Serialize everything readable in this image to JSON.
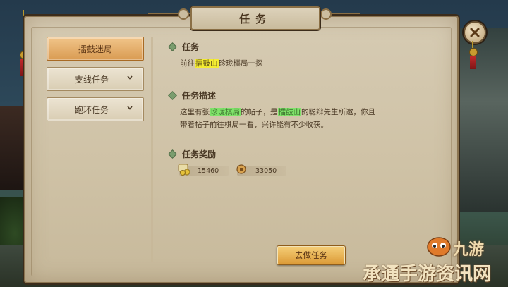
{
  "window": {
    "title": "任务"
  },
  "sidebar": {
    "items": [
      {
        "label": "擂鼓迷局",
        "active": true
      },
      {
        "label": "支线任务",
        "active": false
      },
      {
        "label": "跑环任务",
        "active": false
      }
    ]
  },
  "quest": {
    "objective_title": "任务",
    "objective_prefix": "前往",
    "objective_location": "擂鼓山",
    "objective_suffix": "珍珑棋局一探",
    "description_title": "任务描述",
    "description_p1": "这里有张",
    "description_item": "珍珑棋局",
    "description_p2": "的帖子，是",
    "description_npc": "擂鼓山",
    "description_p3": "的聪辩先生所邀，你且",
    "description_line2": "带着帖子前往棋局一看，兴许能有不少收获。",
    "rewards_title": "任务奖励",
    "rewards": [
      {
        "icon": "exp-scroll-icon",
        "value": "15460"
      },
      {
        "icon": "copper-coin-icon",
        "value": "33050"
      }
    ]
  },
  "actions": {
    "go_label": "去做任务"
  },
  "watermark": {
    "brand": "九游",
    "text": "承通手游资讯网"
  },
  "colors": {
    "highlight_yellow": "#f4ec32",
    "highlight_green": "#7fe26a",
    "active_tab": "#d99b52",
    "panel": "#cfc2a6"
  }
}
